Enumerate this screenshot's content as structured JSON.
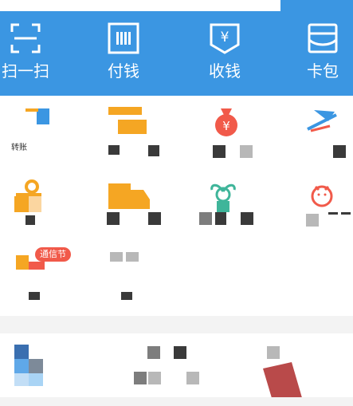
{
  "actions": [
    {
      "label": "扫一扫",
      "icon": "scan-icon"
    },
    {
      "label": "付钱",
      "icon": "pay-barcode-icon"
    },
    {
      "label": "收钱",
      "icon": "receive-money-icon"
    },
    {
      "label": "卡包",
      "icon": "card-wallet-icon"
    }
  ],
  "grid": {
    "items": [
      {
        "label": "转账",
        "icon": "transfer-icon"
      },
      {
        "label": "",
        "icon": "credit-card-repay-icon"
      },
      {
        "label": "",
        "icon": "money-bag-icon"
      },
      {
        "label": "",
        "icon": "travel-plane-icon"
      },
      {
        "label": "",
        "icon": "gift-icon"
      },
      {
        "label": "",
        "icon": "delivery-truck-icon"
      },
      {
        "label": "",
        "icon": "plant-sprout-icon"
      },
      {
        "label": "",
        "icon": "piggy-bank-icon"
      },
      {
        "label": "",
        "icon": "phone-topup-icon",
        "badge": "通信节"
      },
      {
        "label": "",
        "icon": "more-apps-icon"
      }
    ]
  },
  "colors": {
    "brand": "#3b96e2",
    "orange": "#f5a623",
    "red": "#f15a4a",
    "green": "#3fb59a"
  }
}
